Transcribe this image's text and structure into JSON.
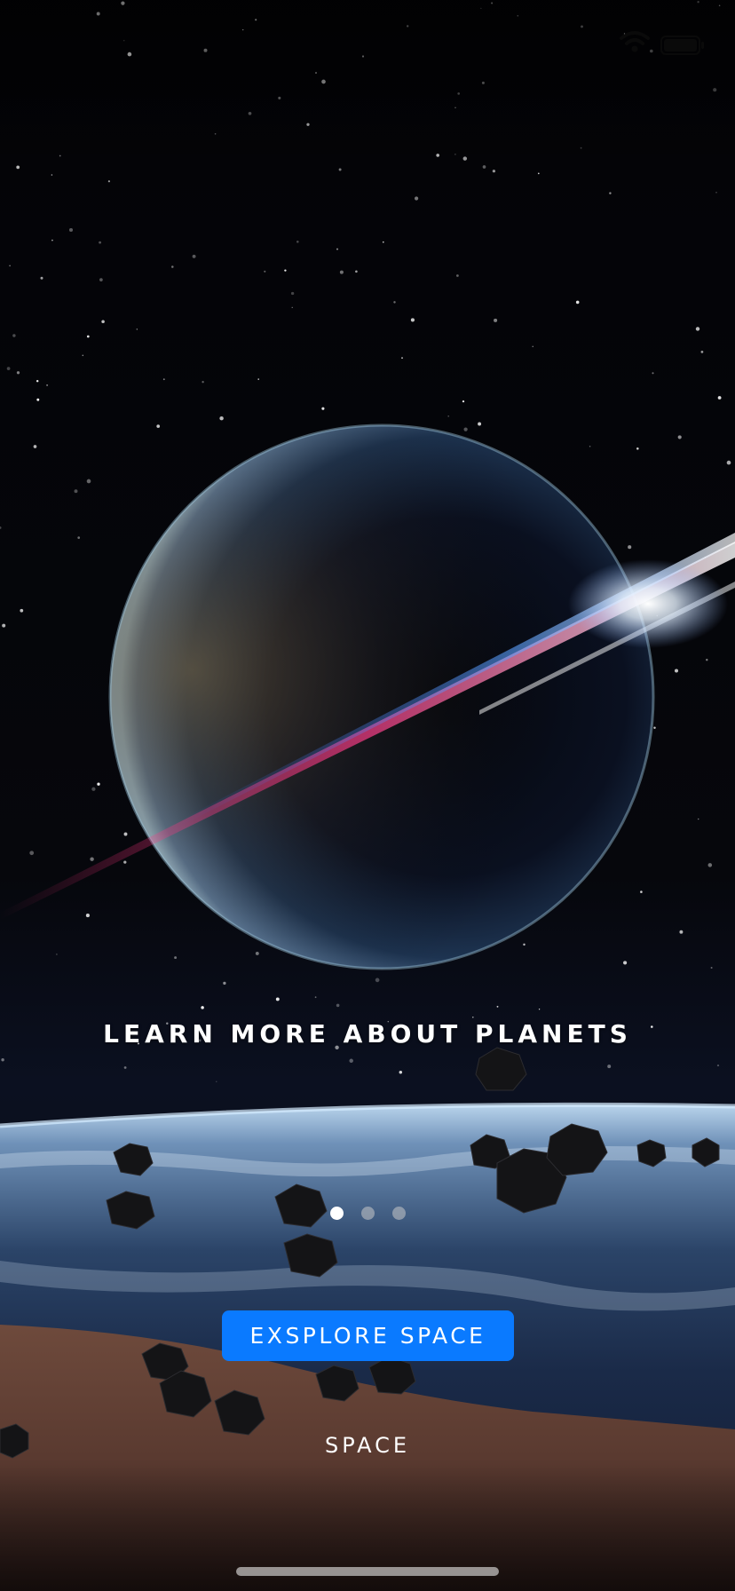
{
  "status_bar": {
    "time": "",
    "wifi_icon": "wifi-icon",
    "battery_icon": "battery-icon"
  },
  "hero": {
    "headline": "LEARN MORE ABOUT PLANETS",
    "image": "planet-with-light-beam-over-earth-and-asteroids"
  },
  "pager": {
    "count": 3,
    "active_index": 0
  },
  "actions": {
    "primary_label": "EXSPLORE SPACE",
    "secondary_label": "SPACE"
  },
  "colors": {
    "accent": "#0A7AFF",
    "text": "#FFFFFF",
    "background": "#030306"
  }
}
